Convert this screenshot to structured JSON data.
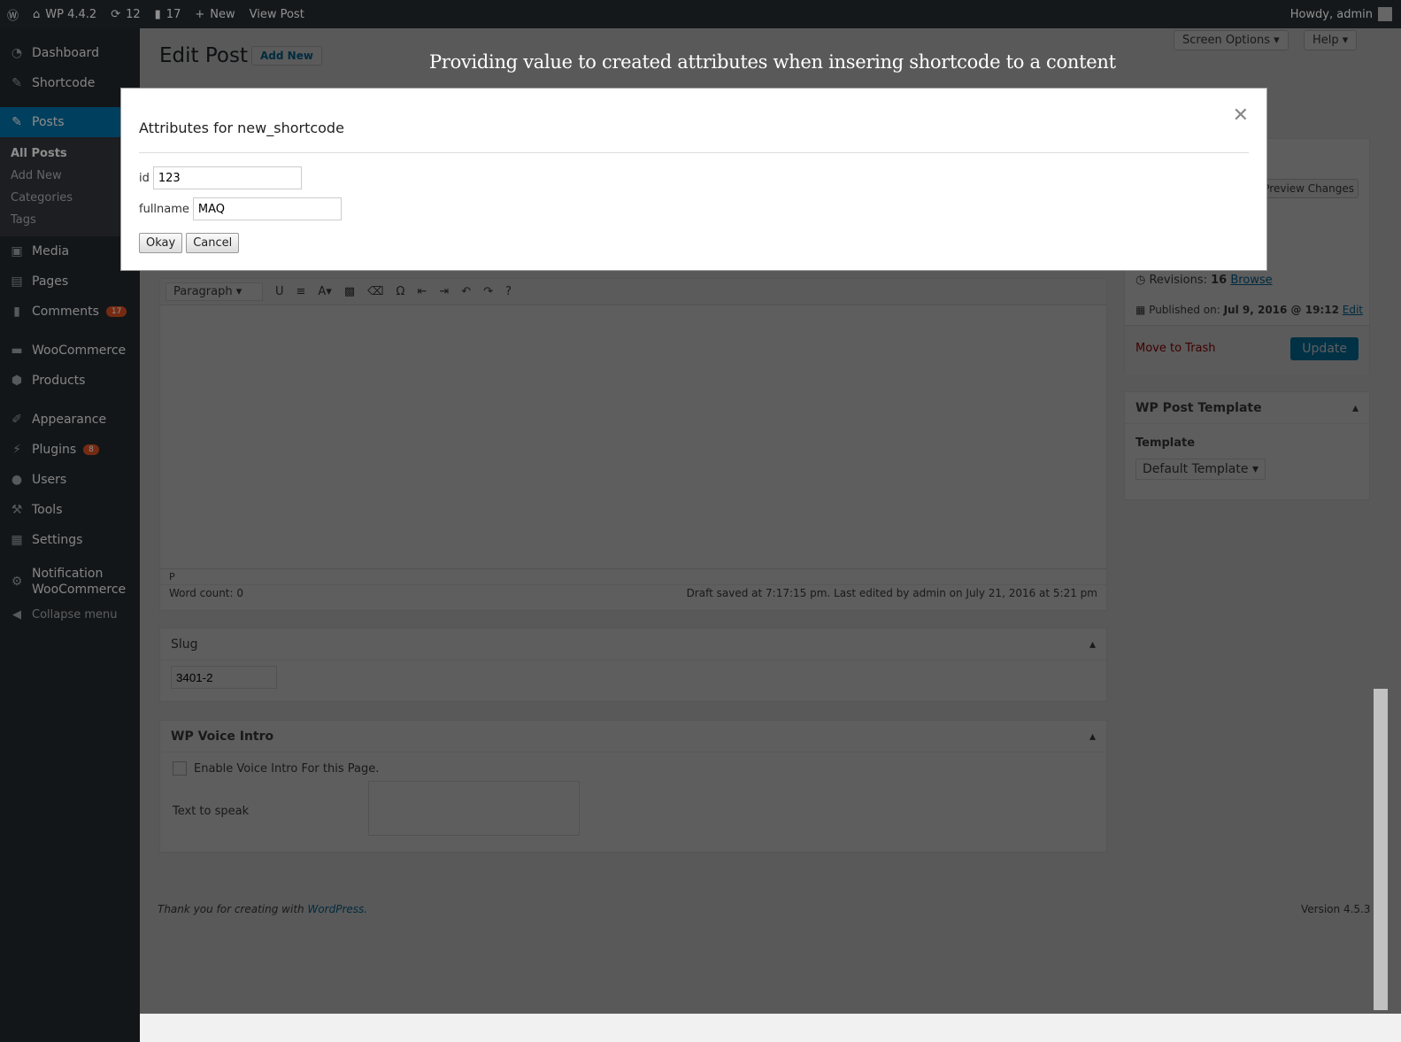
{
  "adminbar": {
    "site": "WP 4.4.2",
    "updates": "12",
    "comments": "17",
    "new": "New",
    "view": "View Post",
    "howdy": "Howdy, admin"
  },
  "sidebar": {
    "items": [
      {
        "label": "Dashboard",
        "icon": "dashboard-icon"
      },
      {
        "label": "Shortcode",
        "icon": "pin-icon"
      },
      {
        "label": "Posts",
        "icon": "pin-icon"
      },
      {
        "label": "Media",
        "icon": "media-icon"
      },
      {
        "label": "Pages",
        "icon": "pages-icon"
      },
      {
        "label": "Comments",
        "icon": "comment-icon",
        "badge": "17"
      },
      {
        "label": "WooCommerce",
        "icon": "woo-icon"
      },
      {
        "label": "Products",
        "icon": "products-icon"
      },
      {
        "label": "Appearance",
        "icon": "brush-icon"
      },
      {
        "label": "Plugins",
        "icon": "plugin-icon",
        "badge": "8"
      },
      {
        "label": "Users",
        "icon": "user-icon"
      },
      {
        "label": "Tools",
        "icon": "wrench-icon"
      },
      {
        "label": "Settings",
        "icon": "settings-icon"
      },
      {
        "label": "Notification WooCommerce",
        "icon": "gear-icon"
      }
    ],
    "posts_sub": [
      "All Posts",
      "Add New",
      "Categories",
      "Tags"
    ],
    "collapse": "Collapse menu"
  },
  "header": {
    "title": "Edit Post",
    "add_new": "Add New",
    "screen_options": "Screen Options",
    "help": "Help"
  },
  "caption": "Providing value to created attributes when insering shortcode to a content",
  "editor": {
    "format": "Paragraph",
    "path": "P",
    "word_count": "Word count: 0",
    "draft": "Draft saved at 7:17:15 pm. Last edited by admin on July 21, 2016 at 5:21 pm"
  },
  "publish": {
    "preview": "Preview Changes",
    "revisions_label": "Revisions:",
    "revisions": "16",
    "browse": "Browse",
    "published_label": "Published on:",
    "published": "Jul 9, 2016 @ 19:12",
    "edit": "Edit",
    "trash": "Move to Trash",
    "update": "Update"
  },
  "template_box": {
    "title": "WP Post Template",
    "label": "Template",
    "value": "Default Template"
  },
  "slug": {
    "title": "Slug",
    "value": "3401-2"
  },
  "voice": {
    "title": "WP Voice Intro",
    "checkbox": "Enable Voice Intro For this Page.",
    "text_label": "Text to speak"
  },
  "footer": {
    "thanks": "Thank you for creating with ",
    "wp": "WordPress.",
    "version": "Version 4.5.3"
  },
  "modal": {
    "title": "Attributes for new_shortcode",
    "fields": [
      {
        "label": "id",
        "value": "123"
      },
      {
        "label": "fullname",
        "value": "MAQ"
      }
    ],
    "ok": "Okay",
    "cancel": "Cancel"
  }
}
